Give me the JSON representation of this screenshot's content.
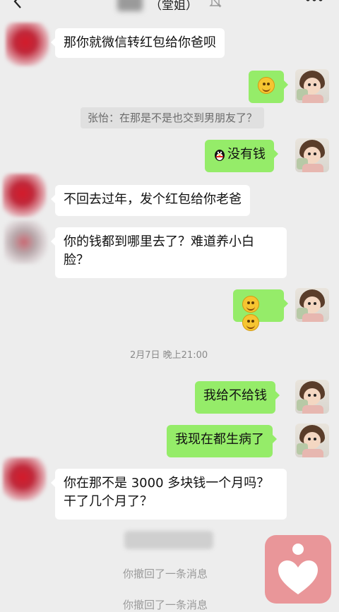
{
  "header": {
    "title": "（堂姐）",
    "back_icon": "chevron-left-icon",
    "mute_icon": "bell-off-icon",
    "more_icon": "more-dots-icon"
  },
  "messages": {
    "m1": "那你就微信转红包给你爸呗",
    "quote": "张怡：在那是不是也交到男朋友了？",
    "m3": "没有钱",
    "m4": "不回去过年，发个红包给你老爸",
    "m5_line1": "你的钱都到哪里去了？难道养小白",
    "m5_line2": "脸？",
    "time": "2月7日 晚上21:00",
    "m7": "我给不给钱",
    "m8": "我现在都生病了",
    "m9_line1": "你在那不是 3000 多块钱一个月吗？",
    "m9_line2": "干了几个月了？"
  },
  "recalls": {
    "r1": "你撤回了一条消息",
    "r2": "你撤回了一条消息"
  },
  "icons": {
    "grin": "grin-emoji-icon",
    "smile": "smile-emoji-icon",
    "qq": "qq-penguin-icon",
    "heart": "heart-icon"
  },
  "colors": {
    "background": "#ededed",
    "bubble_out": "#95ec69",
    "bubble_in": "#ffffff",
    "heart_button": "#e99699"
  }
}
